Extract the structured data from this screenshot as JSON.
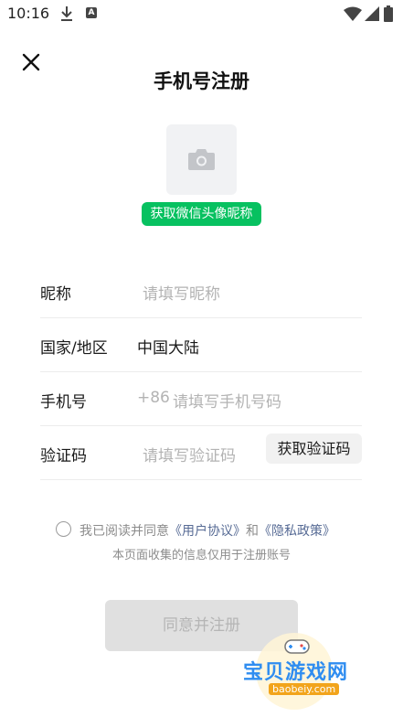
{
  "status_bar": {
    "time": "10:16",
    "icons": [
      "download-icon",
      "a-notification-icon",
      "wifi-icon",
      "signal-icon",
      "battery-icon"
    ]
  },
  "header": {
    "close_icon": "close-icon",
    "title": "手机号注册"
  },
  "avatar": {
    "icon": "camera-icon",
    "wechat_button": "获取微信头像昵称",
    "wechat_button_color": "#07c160"
  },
  "form": {
    "nickname": {
      "label": "昵称",
      "placeholder": "请填写昵称"
    },
    "region": {
      "label": "国家/地区",
      "value": "中国大陆"
    },
    "phone": {
      "label": "手机号",
      "prefix": "+86",
      "placeholder": "请填写手机号码"
    },
    "code": {
      "label": "验证码",
      "placeholder": "请填写验证码",
      "button": "获取验证码"
    }
  },
  "agreement": {
    "prefix": "我已阅读并同意",
    "user_agreement": "《用户协议》",
    "and": "和",
    "privacy_policy": "《隐私政策》",
    "note": "本页面收集的信息仅用于注册账号",
    "link_color": "#576b95"
  },
  "register_button": {
    "label": "同意并注册",
    "state": "disabled"
  },
  "watermark": {
    "text": "宝贝游戏网",
    "domain": "baobeiy.com"
  }
}
